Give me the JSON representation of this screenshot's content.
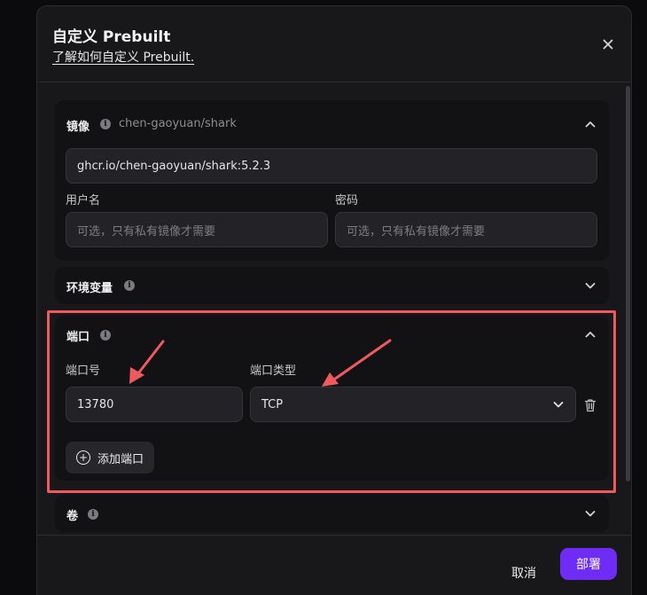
{
  "modal": {
    "title": "自定义 Prebuilt",
    "learn_link": "了解如何自定义 Prebuilt."
  },
  "image_section": {
    "title": "镜像",
    "current_image": "chen-gaoyuan/shark",
    "image_value": "ghcr.io/chen-gaoyuan/shark:5.2.3",
    "username_label": "用户名",
    "username_placeholder": "可选，只有私有镜像才需要",
    "password_label": "密码",
    "password_placeholder": "可选，只有私有镜像才需要"
  },
  "env_section": {
    "title": "环境变量"
  },
  "port_section": {
    "title": "端口",
    "port_number_label": "端口号",
    "port_type_label": "端口类型",
    "port_value": "13780",
    "port_type_value": "TCP",
    "add_port_label": "添加端口"
  },
  "volume_section": {
    "title": "卷"
  },
  "footer": {
    "cancel_label": "取消",
    "deploy_label": "部署"
  },
  "colors": {
    "accent": "#6f2cf5",
    "highlight": "#f05a5e",
    "annotation_arrow": "#f05a5e"
  },
  "icons": {
    "close": "close-icon",
    "info": "info-icon",
    "chevron_up": "chevron-up-icon",
    "chevron_down": "chevron-down-icon",
    "trash": "trash-icon",
    "add": "plus-circle-icon"
  }
}
